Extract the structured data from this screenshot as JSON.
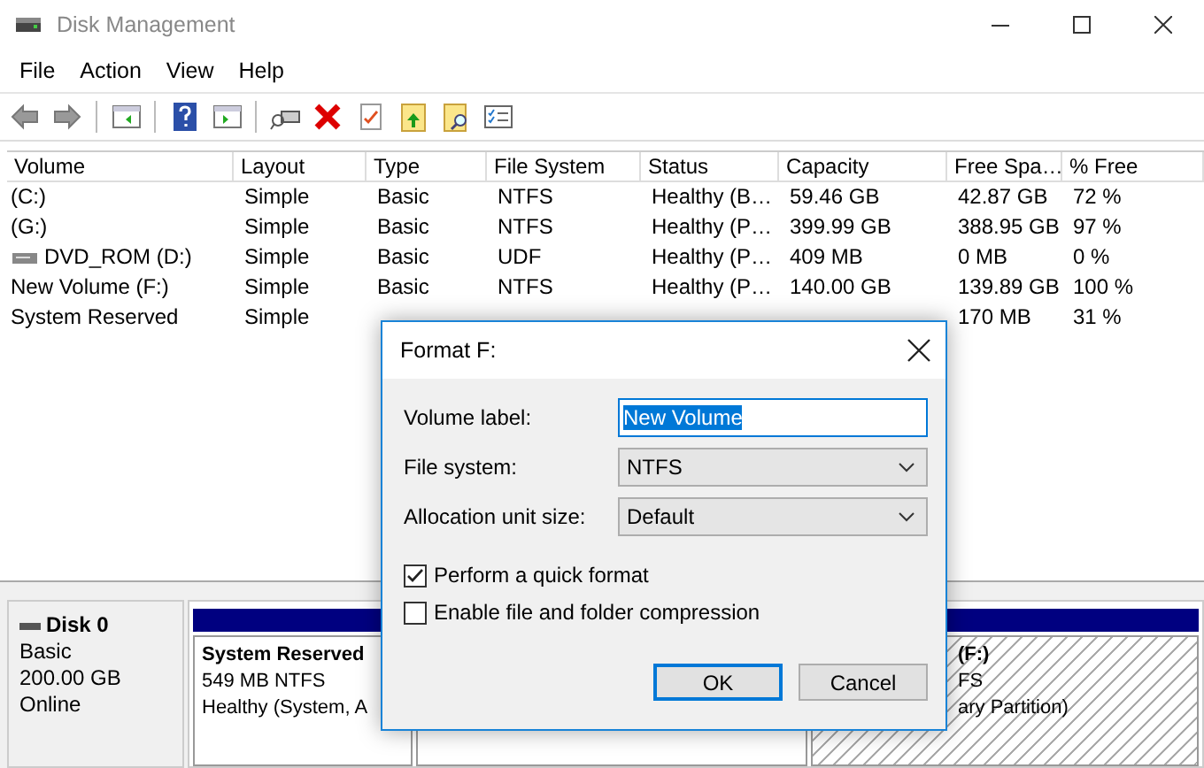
{
  "window": {
    "title": "Disk Management"
  },
  "menu": [
    "File",
    "Action",
    "View",
    "Help"
  ],
  "volumes": {
    "columns": [
      "Volume",
      "Layout",
      "Type",
      "File System",
      "Status",
      "Capacity",
      "Free Spa…",
      "% Free"
    ],
    "rows": [
      {
        "kind": "disk",
        "cells": [
          "(C:)",
          "Simple",
          "Basic",
          "NTFS",
          "Healthy (B…",
          "59.46 GB",
          "42.87 GB",
          "72 %"
        ]
      },
      {
        "kind": "disk",
        "cells": [
          "(G:)",
          "Simple",
          "Basic",
          "NTFS",
          "Healthy (P…",
          "399.99 GB",
          "388.95 GB",
          "97 %"
        ]
      },
      {
        "kind": "disc",
        "cells": [
          "DVD_ROM (D:)",
          "Simple",
          "Basic",
          "UDF",
          "Healthy (P…",
          "409 MB",
          "0 MB",
          "0 %"
        ]
      },
      {
        "kind": "disk",
        "cells": [
          "New Volume (F:)",
          "Simple",
          "Basic",
          "NTFS",
          "Healthy (P…",
          "140.00 GB",
          "139.89 GB",
          "100 %"
        ]
      },
      {
        "kind": "disk",
        "cells": [
          "System Reserved",
          "Simple",
          "",
          "",
          "",
          "",
          "170 MB",
          "31 %"
        ]
      }
    ]
  },
  "disk": {
    "name": "Disk 0",
    "type": "Basic",
    "size": "200.00 GB",
    "status": "Online",
    "partitions": [
      {
        "selected": false,
        "lines": [
          "System Reserved",
          "549 MB NTFS",
          "Healthy (System, A"
        ]
      },
      {
        "selected": false
      },
      {
        "selected": true,
        "lines": [
          "(F:)",
          "FS",
          "ary Partition)"
        ]
      }
    ]
  },
  "dialog": {
    "title": "Format F:",
    "fields": [
      {
        "kind": "text",
        "label": "Volume label:",
        "value": "New Volume",
        "selected": true
      },
      {
        "kind": "dropdown",
        "label": "File system:",
        "value": "NTFS"
      },
      {
        "kind": "dropdown",
        "label": "Allocation unit size:",
        "value": "Default"
      }
    ],
    "checkboxes": [
      {
        "label": "Perform a quick format",
        "checked": true
      },
      {
        "label": "Enable file and folder compression",
        "checked": false
      }
    ],
    "buttons": [
      {
        "label": "OK",
        "default": true
      },
      {
        "label": "Cancel",
        "default": false
      }
    ]
  }
}
